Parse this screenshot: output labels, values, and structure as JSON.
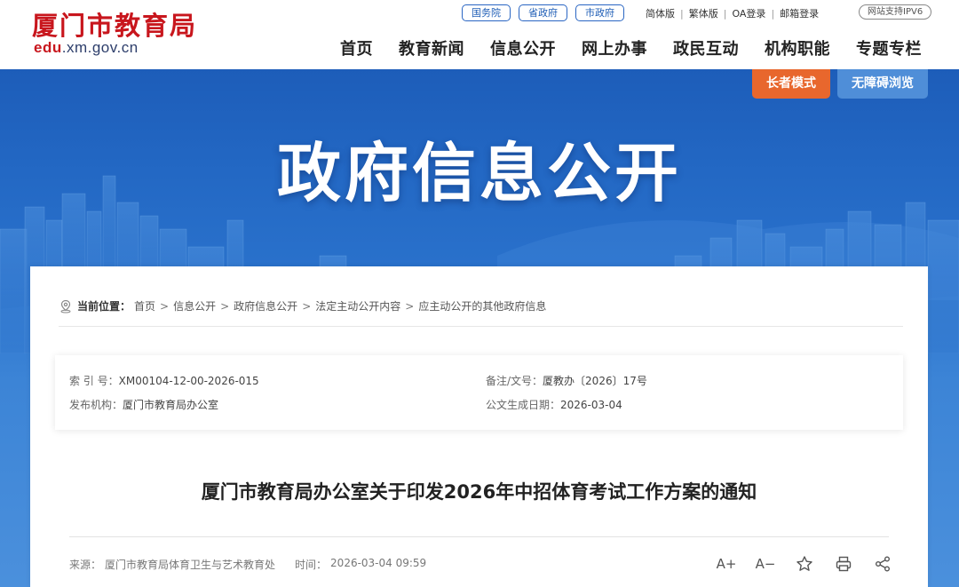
{
  "header": {
    "logo_cn": "厦门市教育局",
    "logo_domain_bold": "edu",
    "logo_domain_rest": ".xm.gov.cn",
    "gov_links": [
      "国务院",
      "省政府",
      "市政府"
    ],
    "util_links": [
      "简体版",
      "繁体版",
      "OA登录",
      "邮箱登录"
    ],
    "ipv6": "网站支持IPV6",
    "nav": [
      "首页",
      "教育新闻",
      "信息公开",
      "网上办事",
      "政民互动",
      "机构职能",
      "专题专栏"
    ]
  },
  "banner": {
    "title": "政府信息公开",
    "elder_mode": "长者模式",
    "accessible": "无障碍浏览"
  },
  "breadcrumb": {
    "label": "当前位置：",
    "items": [
      "首页",
      "信息公开",
      "政府信息公开",
      "法定主动公开内容",
      "应主动公开的其他政府信息"
    ]
  },
  "meta": {
    "index_key": "索 引 号：",
    "index_val": "XM00104-12-00-2026-015",
    "note_key": "备注/文号：",
    "note_val": "厦教办〔2026〕17号",
    "org_key": "发布机构：",
    "org_val": "厦门市教育局办公室",
    "date_key": "公文生成日期：",
    "date_val": "2026-03-04"
  },
  "document": {
    "title": "厦门市教育局办公室关于印发2026年中招体育考试工作方案的通知",
    "source_key": "来源：",
    "source_val": "厦门市教育局体育卫生与艺术教育处",
    "time_key": "时间：",
    "time_val": "2026-03-04 09:59"
  },
  "tools": {
    "font_up": "A+",
    "font_down": "A−"
  },
  "colors": {
    "brand_red": "#c8161d",
    "nav_blue": "#1f5eb6",
    "elder_orange": "#e8672d",
    "access_blue": "#4f8ed8",
    "banner_blue": "#2368c4"
  }
}
